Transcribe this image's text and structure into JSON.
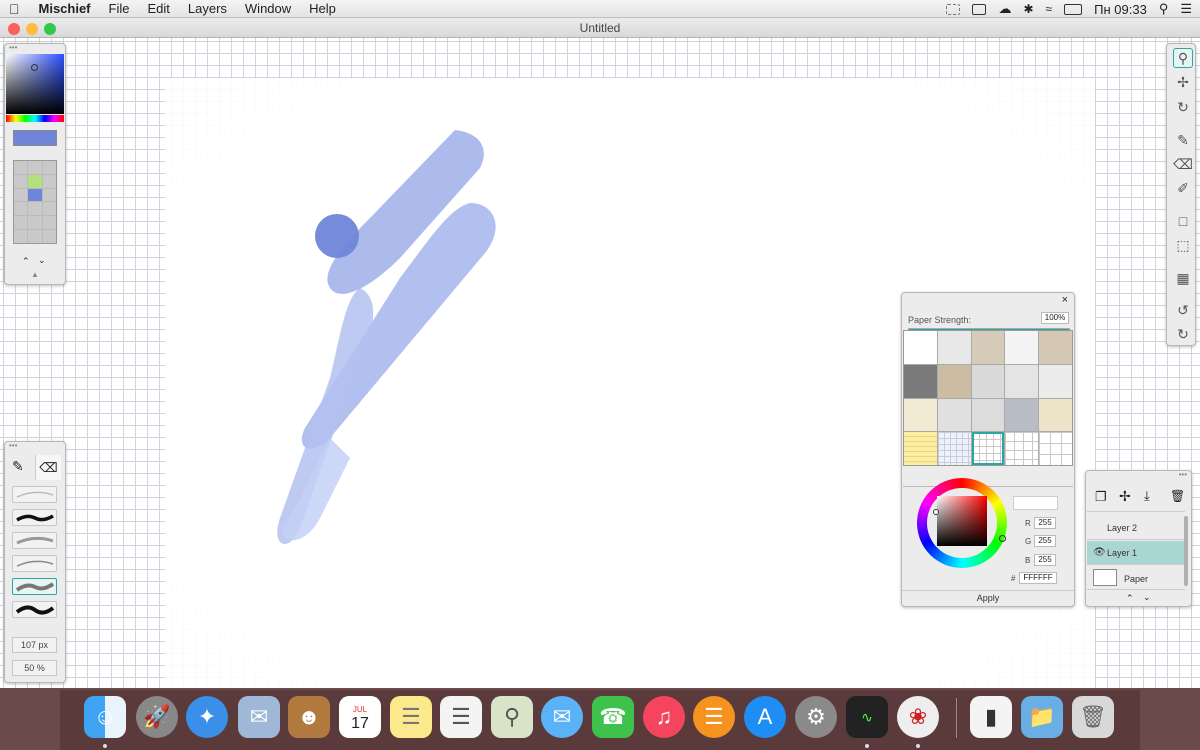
{
  "menubar": {
    "apple": "",
    "app_name": "Mischief",
    "items": [
      "File",
      "Edit",
      "Layers",
      "Window",
      "Help"
    ],
    "clock": "Пн 09:33"
  },
  "window": {
    "title": "Untitled"
  },
  "colors": {
    "stroke": "#9fb0ec",
    "brush_dot": "#6f86d8",
    "accent": "#2aa7a0",
    "current_color": "#6f86d8"
  },
  "brush_panel": {
    "size": "107 px",
    "opacity": "50 %"
  },
  "paper_panel": {
    "label": "Paper Strength:",
    "strength": "100%",
    "strength_fraction": 1.0,
    "r_label": "R",
    "g_label": "G",
    "b_label": "B",
    "hash_label": "#",
    "r": "255",
    "g": "255",
    "b": "255",
    "hex": "FFFFFF",
    "apply": "Apply",
    "close": "×"
  },
  "layers_panel": {
    "layers": [
      "Layer 2",
      "Layer 1",
      "Paper"
    ]
  },
  "dock": {
    "calendar_month": "JUL",
    "calendar_day": "17"
  }
}
